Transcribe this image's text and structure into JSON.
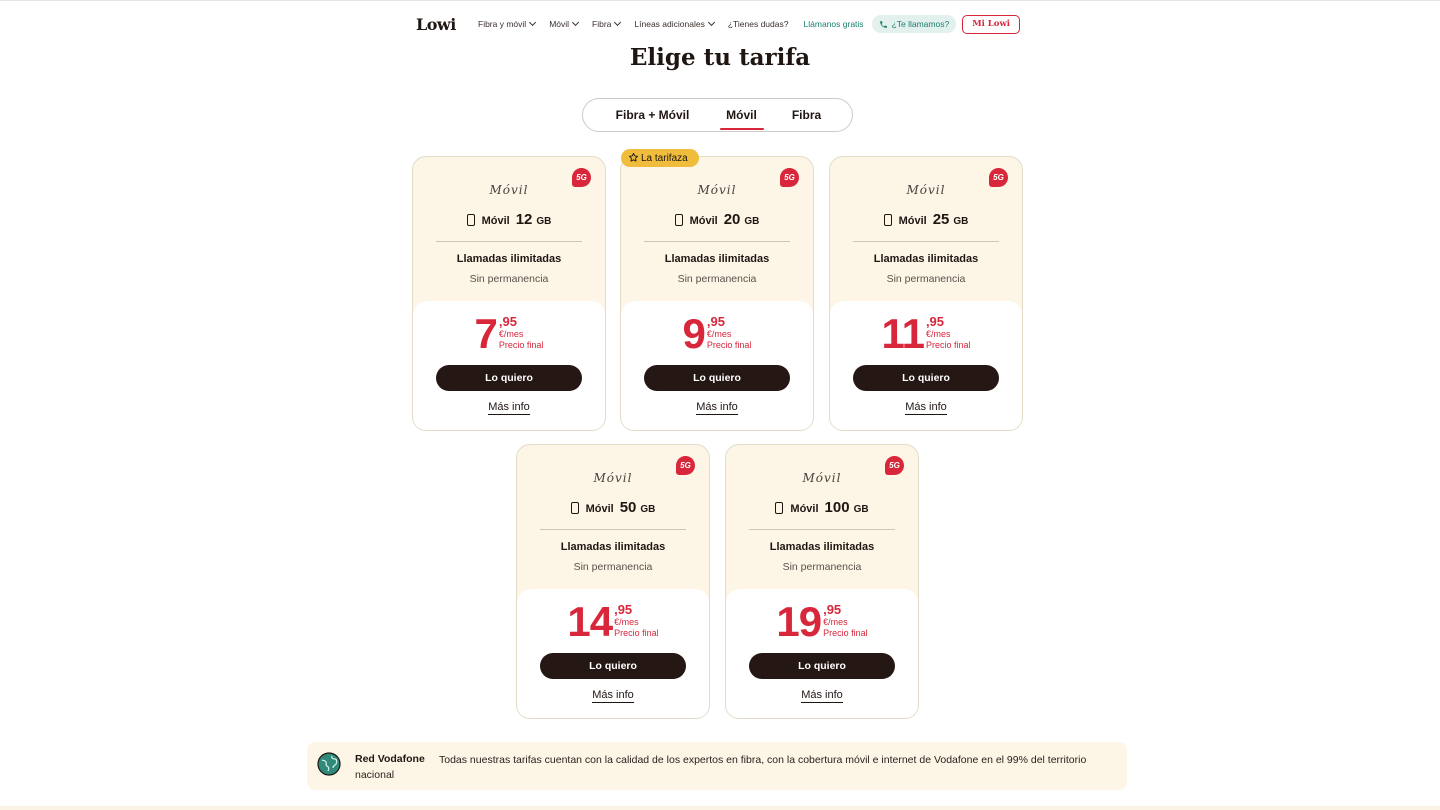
{
  "header": {
    "logo": "Lowi",
    "nav": [
      "Fibra y móvil",
      "Móvil",
      "Fibra",
      "Líneas adicionales",
      "¿Tienes dudas?"
    ],
    "call_free": "Llámanos gratis",
    "call_back": "¿Te llamamos?",
    "account": "Mi Lowi"
  },
  "page_title": "Elige tu tarifa",
  "tabs": [
    {
      "label": "Fibra + Móvil",
      "active": false
    },
    {
      "label": "Móvil",
      "active": true
    },
    {
      "label": "Fibra",
      "active": false
    }
  ],
  "cards": [
    {
      "badge": "5G",
      "script": "Móvil",
      "name": "Móvil",
      "gb": "12",
      "unit": "GB",
      "calls": "Llamadas ilimitadas",
      "permanence": "Sin permanencia",
      "price_int": "7",
      "price_dec": ",95",
      "price_per": "€/mes",
      "price_final": "Precio final",
      "cta": "Lo quiero",
      "more": "Más info"
    },
    {
      "badge": "5G",
      "featured": "La tarifaza",
      "script": "Móvil",
      "name": "Móvil",
      "gb": "20",
      "unit": "GB",
      "calls": "Llamadas ilimitadas",
      "permanence": "Sin permanencia",
      "price_int": "9",
      "price_dec": ",95",
      "price_per": "€/mes",
      "price_final": "Precio final",
      "cta": "Lo quiero",
      "more": "Más info"
    },
    {
      "badge": "5G",
      "script": "Móvil",
      "name": "Móvil",
      "gb": "25",
      "unit": "GB",
      "calls": "Llamadas ilimitadas",
      "permanence": "Sin permanencia",
      "price_int": "11",
      "price_dec": ",95",
      "price_per": "€/mes",
      "price_final": "Precio final",
      "cta": "Lo quiero",
      "more": "Más info"
    },
    {
      "badge": "5G",
      "script": "Móvil",
      "name": "Móvil",
      "gb": "50",
      "unit": "GB",
      "calls": "Llamadas ilimitadas",
      "permanence": "Sin permanencia",
      "price_int": "14",
      "price_dec": ",95",
      "price_per": "€/mes",
      "price_final": "Precio final",
      "cta": "Lo quiero",
      "more": "Más info"
    },
    {
      "badge": "5G",
      "script": "Móvil",
      "name": "Móvil",
      "gb": "100",
      "unit": "GB",
      "calls": "Llamadas ilimitadas",
      "permanence": "Sin permanencia",
      "price_int": "19",
      "price_dec": ",95",
      "price_per": "€/mes",
      "price_final": "Precio final",
      "cta": "Lo quiero",
      "more": "Más info"
    }
  ],
  "info": {
    "title": "Red Vodafone",
    "text": "Todas nuestras tarifas cuentan con la calidad de los expertos en fibra, con la cobertura móvil e internet de Vodafone en el 99% del territorio nacional"
  },
  "colors": {
    "accent": "#d8263a",
    "dark": "#241714",
    "cream": "#fdf6e7",
    "featured": "#efbd3b",
    "teal": "#1a7f6e"
  },
  "icons": {
    "phone": "phone-icon",
    "star": "star-icon",
    "device": "smartphone-icon",
    "globe": "globe-icon",
    "chevron": "chevron-down-icon"
  }
}
